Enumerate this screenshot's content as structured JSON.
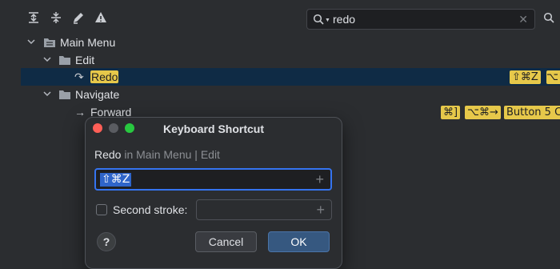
{
  "search": {
    "value": "redo"
  },
  "tree": {
    "main_menu": "Main Menu",
    "edit": "Edit",
    "redo": "Redo",
    "redo_shortcut": "⇧⌘Z",
    "navigate": "Navigate",
    "forward": "Forward",
    "forward_shortcuts": [
      "⌘]",
      "⌥⌘→",
      "Button 5 C"
    ]
  },
  "dialog": {
    "title": "Keyboard Shortcut",
    "action": "Redo",
    "path": "in Main Menu | Edit",
    "first_stroke": "⇧⌘Z",
    "second_stroke_label": "Second stroke:",
    "second_stroke_value": "",
    "help": "?",
    "cancel": "Cancel",
    "ok": "OK"
  },
  "colors": {
    "highlight": "#e6c84a",
    "selection": "#0f2b45",
    "accent": "#3574f0"
  }
}
